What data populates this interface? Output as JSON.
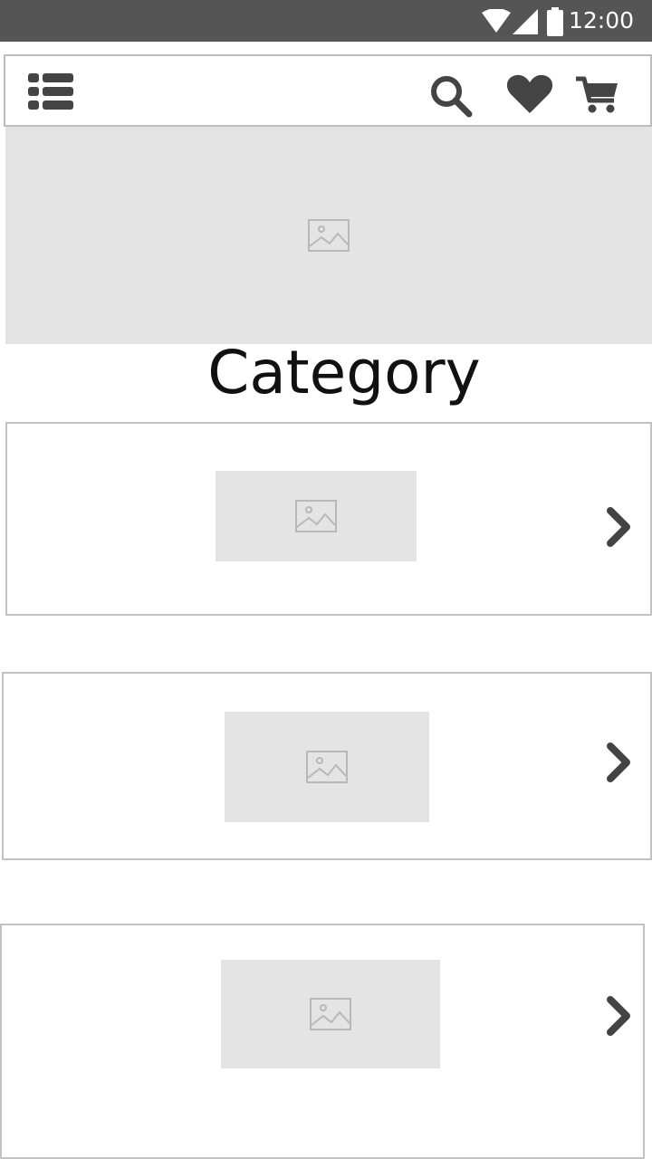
{
  "status_bar": {
    "time": "12:00",
    "icons": [
      "wifi-icon",
      "signal-icon",
      "battery-icon"
    ]
  },
  "header": {
    "icons": [
      "list-menu-icon",
      "search-icon",
      "heart-icon",
      "cart-icon"
    ]
  },
  "hero": {
    "icon": "image-placeholder-icon"
  },
  "page": {
    "title": "Category"
  },
  "categories": [
    {
      "icon": "image-placeholder-icon",
      "action_icon": "chevron-right-icon"
    },
    {
      "icon": "image-placeholder-icon",
      "action_icon": "chevron-right-icon"
    },
    {
      "icon": "image-placeholder-icon",
      "action_icon": "chevron-right-icon"
    }
  ],
  "colors": {
    "status_bar": "#555555",
    "icon": "#444444",
    "placeholder_bg": "#e4e4e4",
    "border": "#bdbdbd",
    "text": "#111111"
  }
}
